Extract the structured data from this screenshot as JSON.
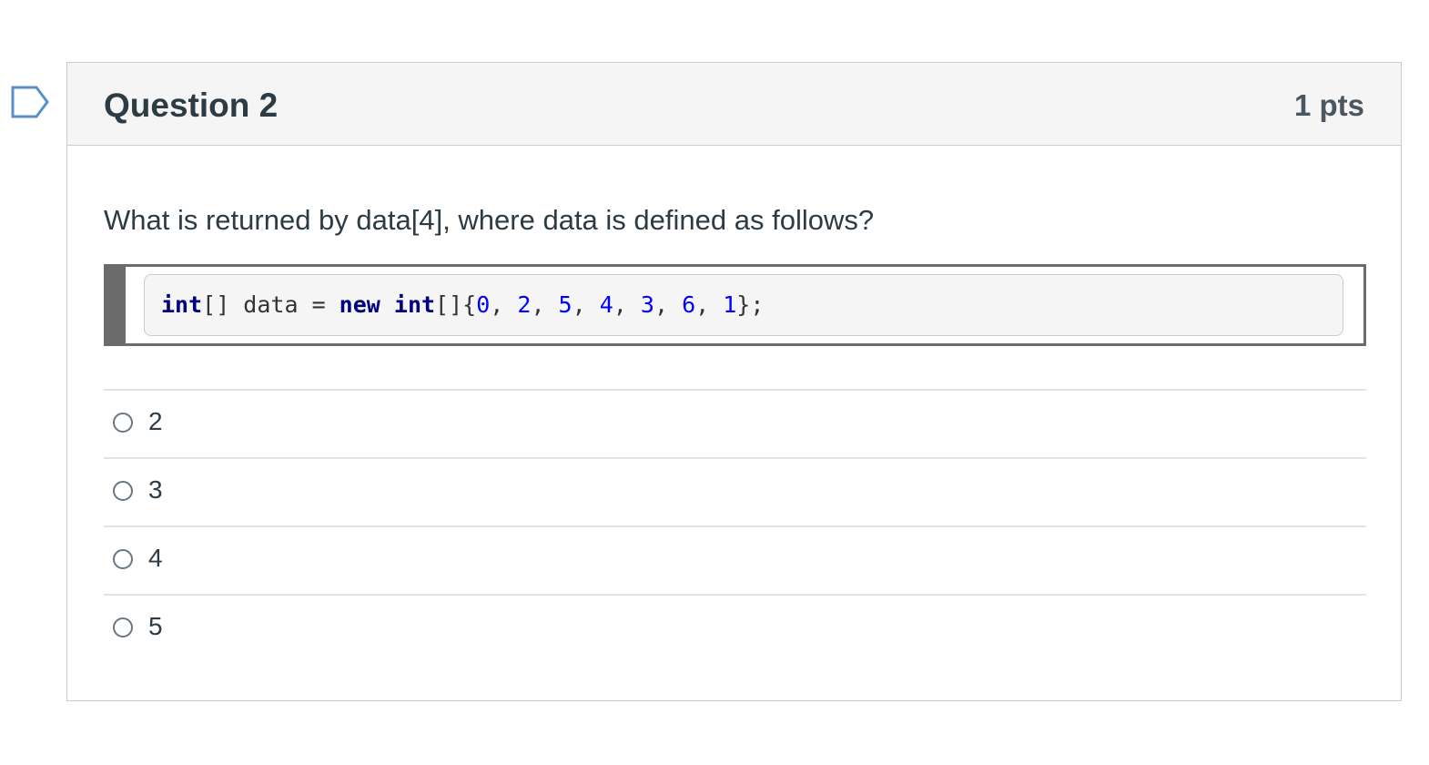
{
  "question": {
    "title": "Question 2",
    "points": "1 pts",
    "prompt": "What is returned by data[4], where data is defined as follows?",
    "code": {
      "tokens": [
        {
          "text": "int",
          "kind": "kw"
        },
        {
          "text": "[] data = ",
          "kind": "plain"
        },
        {
          "text": "new",
          "kind": "kw"
        },
        {
          "text": " ",
          "kind": "plain"
        },
        {
          "text": "int",
          "kind": "kw"
        },
        {
          "text": "[]{",
          "kind": "plain"
        },
        {
          "text": "0",
          "kind": "num"
        },
        {
          "text": ", ",
          "kind": "plain"
        },
        {
          "text": "2",
          "kind": "num"
        },
        {
          "text": ", ",
          "kind": "plain"
        },
        {
          "text": "5",
          "kind": "num"
        },
        {
          "text": ", ",
          "kind": "plain"
        },
        {
          "text": "4",
          "kind": "num"
        },
        {
          "text": ", ",
          "kind": "plain"
        },
        {
          "text": "3",
          "kind": "num"
        },
        {
          "text": ", ",
          "kind": "plain"
        },
        {
          "text": "6",
          "kind": "num"
        },
        {
          "text": ", ",
          "kind": "plain"
        },
        {
          "text": "1",
          "kind": "num"
        },
        {
          "text": "};",
          "kind": "plain"
        }
      ]
    },
    "answers": [
      "2",
      "3",
      "4",
      "5"
    ]
  },
  "colors": {
    "keyword": "#000080",
    "number": "#0000ff",
    "header_bg": "#f5f5f5",
    "flag_outline": "#5b8fc7"
  },
  "icons": {
    "flag": "bookmark-flag-icon"
  }
}
